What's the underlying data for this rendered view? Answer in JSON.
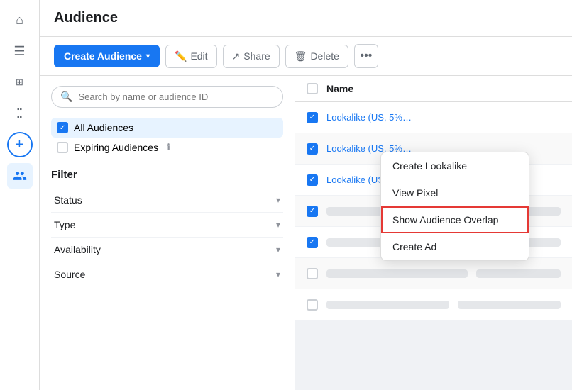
{
  "page": {
    "title": "Audience"
  },
  "sidebar": {
    "icons": [
      {
        "name": "home-icon",
        "symbol": "⌂",
        "active": false
      },
      {
        "name": "menu-icon",
        "symbol": "☰",
        "active": false
      },
      {
        "name": "grid-icon",
        "symbol": "⊞",
        "active": false
      },
      {
        "name": "square-icon",
        "symbol": "▪",
        "active": false
      },
      {
        "name": "add-icon",
        "symbol": "+",
        "active": false
      },
      {
        "name": "people-icon",
        "symbol": "👥",
        "active": true
      }
    ]
  },
  "toolbar": {
    "create_label": "Create Audience",
    "edit_label": "Edit",
    "share_label": "Share",
    "delete_label": "Delete",
    "more_label": "•••"
  },
  "search": {
    "placeholder": "Search by name or audience ID"
  },
  "filters": {
    "options": [
      {
        "label": "All Audiences",
        "checked": true
      },
      {
        "label": "Expiring Audiences",
        "checked": false,
        "hasInfo": true
      }
    ],
    "title": "Filter",
    "rows": [
      {
        "label": "Status"
      },
      {
        "label": "Type"
      },
      {
        "label": "Availability"
      },
      {
        "label": "Source"
      }
    ]
  },
  "table": {
    "header": "Name",
    "rows": [
      {
        "checked": true,
        "text": "Lookalike (US, 5%…",
        "isLink": true,
        "blurred": false
      },
      {
        "checked": true,
        "text": "Lookalike (US, 5%…",
        "isLink": true,
        "blurred": false
      },
      {
        "checked": true,
        "text": "Lookalike (US, 5%) - 60D:PUR-1024",
        "isLink": true,
        "blurred": false
      },
      {
        "checked": true,
        "text": "",
        "isLink": false,
        "blurred": true
      },
      {
        "checked": true,
        "text": "",
        "isLink": false,
        "blurred": true
      },
      {
        "checked": false,
        "text": "",
        "isLink": false,
        "blurred": true
      },
      {
        "checked": false,
        "text": "",
        "isLink": false,
        "blurred": true
      }
    ]
  },
  "dropdown": {
    "items": [
      {
        "label": "Create Lookalike",
        "highlighted": false
      },
      {
        "label": "View Pixel",
        "highlighted": false
      },
      {
        "label": "Show Audience Overlap",
        "highlighted": true
      },
      {
        "label": "Create Ad",
        "highlighted": false
      }
    ]
  }
}
